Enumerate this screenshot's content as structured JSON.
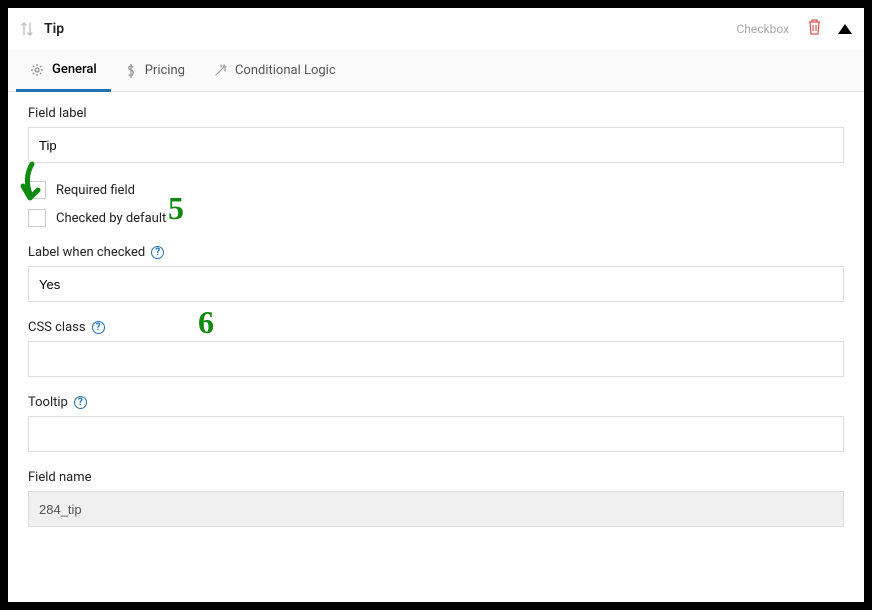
{
  "header": {
    "title": "Tip",
    "type_label": "Checkbox"
  },
  "tabs": {
    "general": "General",
    "pricing": "Pricing",
    "conditional": "Conditional Logic"
  },
  "fields": {
    "field_label_label": "Field label",
    "field_label_value": "Tip",
    "required_label": "Required field",
    "checked_default_label": "Checked by default",
    "label_when_checked_label": "Label when checked",
    "label_when_checked_value": "Yes",
    "css_class_label": "CSS class",
    "css_class_value": "",
    "tooltip_label": "Tooltip",
    "tooltip_value": "",
    "field_name_label": "Field name",
    "field_name_value": "284_tip"
  },
  "annotations": {
    "num5": "5",
    "num6": "6"
  }
}
